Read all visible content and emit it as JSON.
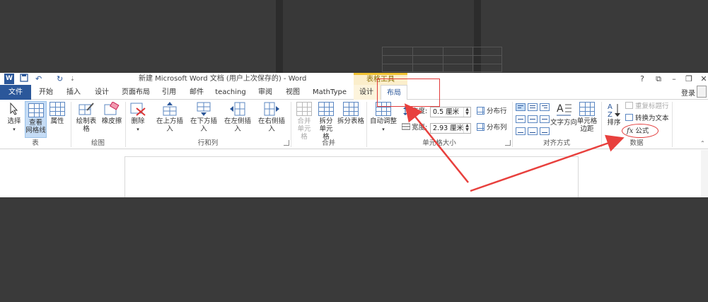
{
  "window": {
    "title": "新建 Microsoft Word 文档 (用户上次保存的) - Word",
    "context_group": "表格工具",
    "controls": [
      "?",
      "⧉",
      "–",
      "❐",
      "✕"
    ]
  },
  "quick_access": {
    "undo": "↶",
    "redo": "↻",
    "more": "⇣"
  },
  "tabs": [
    {
      "label": "文件"
    },
    {
      "label": "开始"
    },
    {
      "label": "插入"
    },
    {
      "label": "设计"
    },
    {
      "label": "页面布局"
    },
    {
      "label": "引用"
    },
    {
      "label": "邮件"
    },
    {
      "label": "teaching"
    },
    {
      "label": "审阅"
    },
    {
      "label": "视图"
    },
    {
      "label": "MathType"
    },
    {
      "label": "设计"
    },
    {
      "label": "布局"
    }
  ],
  "account": {
    "login": "登录"
  },
  "ribbon": {
    "groups": {
      "table": "表",
      "draw": "绘图",
      "rows_cols": "行和列",
      "merge": "合并",
      "cell_size": "单元格大小",
      "alignment": "对齐方式",
      "data": "数据"
    },
    "table_buttons": {
      "select": "选择",
      "view_gridlines_1": "查看",
      "view_gridlines_2": "网格线",
      "properties": "属性"
    },
    "draw_buttons": {
      "draw_table": "绘制表格",
      "eraser": "橡皮擦"
    },
    "rowcol_buttons": {
      "delete": "删除",
      "insert_above": "在上方插入",
      "insert_below": "在下方插入",
      "insert_left": "在左侧插入",
      "insert_right": "在右侧插入"
    },
    "merge_buttons": {
      "merge_1": "合并",
      "merge_2": "单元格",
      "split_1": "拆分",
      "split_2": "单元格",
      "split_table": "拆分表格"
    },
    "cell_size": {
      "autofit": "自动调整",
      "height_label": "高度:",
      "height_value": "0.5 厘米",
      "width_label": "宽度:",
      "width_value": "2.93 厘米",
      "distribute_rows": "分布行",
      "distribute_cols": "分布列"
    },
    "alignment_buttons": {
      "text_direction": "文字方向",
      "cell_margins_1": "单元格",
      "cell_margins_2": "边距"
    },
    "data_buttons": {
      "sort": "排序",
      "repeat_header": "重复标题行",
      "convert_to_text": "转换为文本",
      "formula": "公式",
      "fx": "fx"
    }
  },
  "colors": {
    "accent": "#2b579a",
    "context_tab": "#f1c232",
    "annotation": "#e23b3b"
  }
}
